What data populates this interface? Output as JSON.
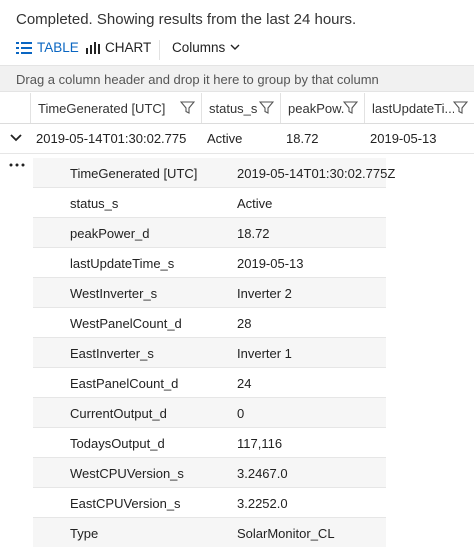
{
  "status": {
    "text": "Completed. Showing results from the last 24 hours."
  },
  "toolbar": {
    "table_label": "TABLE",
    "chart_label": "CHART",
    "columns_label": "Columns",
    "active_color": "#0a66c2"
  },
  "group_bar": {
    "text": "Drag a column header and drop it here to group by that column"
  },
  "columns": [
    {
      "label": "TimeGenerated [UTC]"
    },
    {
      "label": "status_s"
    },
    {
      "label": "peakPow..."
    },
    {
      "label": "lastUpdateTi..."
    }
  ],
  "row": {
    "cells": [
      "2019-05-14T01:30:02.775",
      "Active",
      "18.72",
      "2019-05-13"
    ]
  },
  "details": [
    {
      "key": "TimeGenerated [UTC]",
      "value": "2019-05-14T01:30:02.775Z"
    },
    {
      "key": "status_s",
      "value": "Active"
    },
    {
      "key": "peakPower_d",
      "value": "18.72"
    },
    {
      "key": "lastUpdateTime_s",
      "value": "2019-05-13"
    },
    {
      "key": "WestInverter_s",
      "value": "Inverter 2"
    },
    {
      "key": "WestPanelCount_d",
      "value": "28"
    },
    {
      "key": "EastInverter_s",
      "value": "Inverter 1"
    },
    {
      "key": "EastPanelCount_d",
      "value": "24"
    },
    {
      "key": "CurrentOutput_d",
      "value": "0"
    },
    {
      "key": "TodaysOutput_d",
      "value": "117,116"
    },
    {
      "key": "WestCPUVersion_s",
      "value": "3.2467.0"
    },
    {
      "key": "EastCPUVersion_s",
      "value": "3.2252.0"
    },
    {
      "key": "Type",
      "value": "SolarMonitor_CL"
    }
  ],
  "icons": {
    "table": "table-list-icon",
    "chart": "bar-chart-icon",
    "columns": "chevron-down-icon",
    "filter": "funnel-filter-icon",
    "expand": "chevron-down-icon",
    "more": "ellipsis-icon"
  }
}
